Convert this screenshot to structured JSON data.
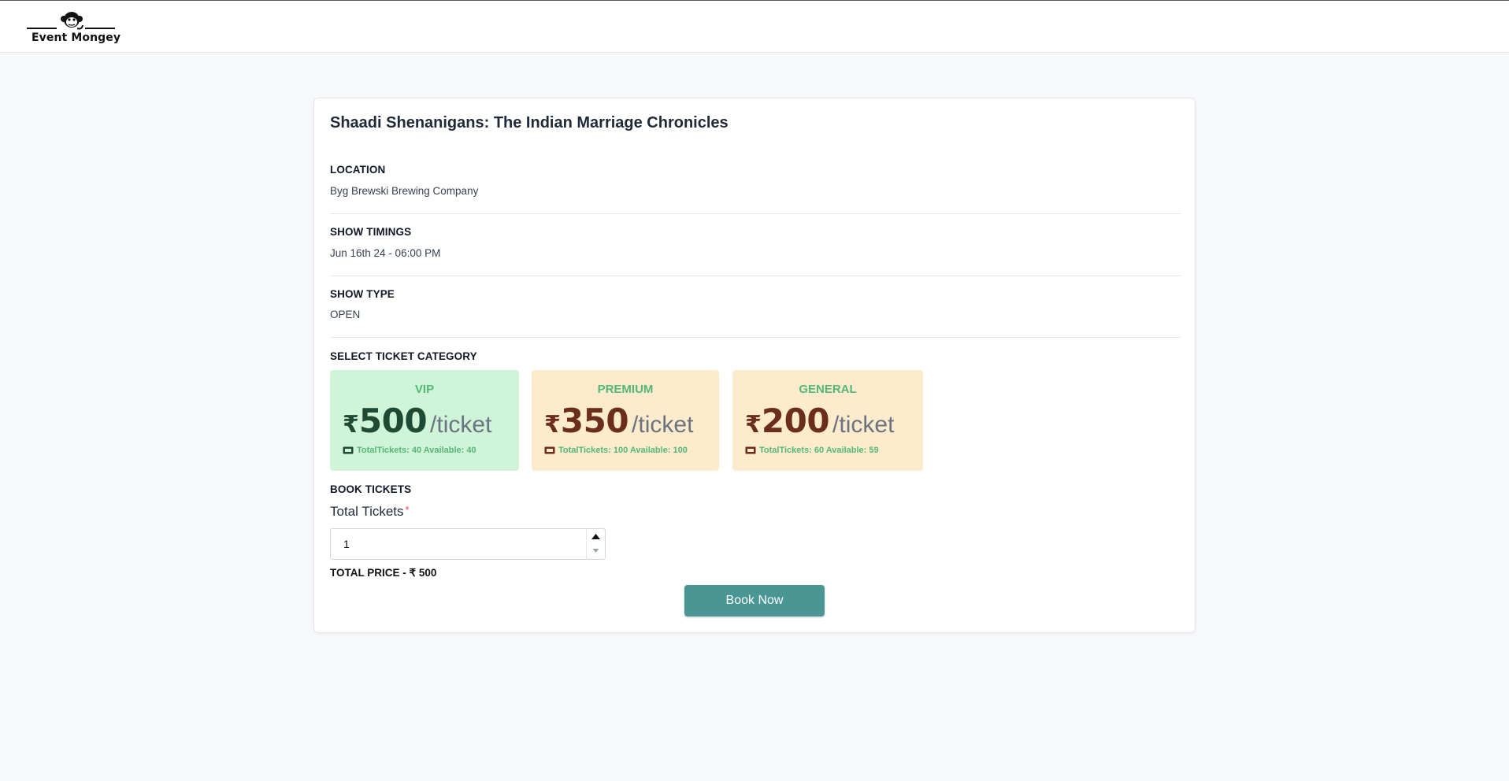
{
  "brand": {
    "name": "Event Mongey",
    "logo_icon": "monkey-icon"
  },
  "event": {
    "title": "Shaadi Shenanigans: The Indian Marriage Chronicles"
  },
  "details": {
    "location_label": "LOCATION",
    "location_value": "Byg Brewski Brewing Company",
    "timings_label": "SHOW TIMINGS",
    "timings_value": "Jun 16th 24 - 06:00 PM",
    "type_label": "SHOW TYPE",
    "type_value": "OPEN"
  },
  "tickets": {
    "section_label": "SELECT TICKET CATEGORY",
    "currency_symbol": "₹",
    "per_label": "/ticket",
    "selected": "VIP",
    "categories": [
      {
        "name": "VIP",
        "price": "500",
        "stats": "TotalTickets: 40  Available: 40",
        "bg": "#cff4d8"
      },
      {
        "name": "PREMIUM",
        "price": "350",
        "stats": "TotalTickets: 100  Available: 100",
        "bg": "#fcebcc"
      },
      {
        "name": "GENERAL",
        "price": "200",
        "stats": "TotalTickets: 60  Available: 59",
        "bg": "#fcebcc"
      }
    ]
  },
  "booking": {
    "section_label": "BOOK TICKETS",
    "field_label": "Total Tickets",
    "required_marker": "*",
    "quantity": "1",
    "total_price": "TOTAL PRICE - ₹ 500",
    "book_button": "Book Now",
    "accent": "#4a9694"
  }
}
